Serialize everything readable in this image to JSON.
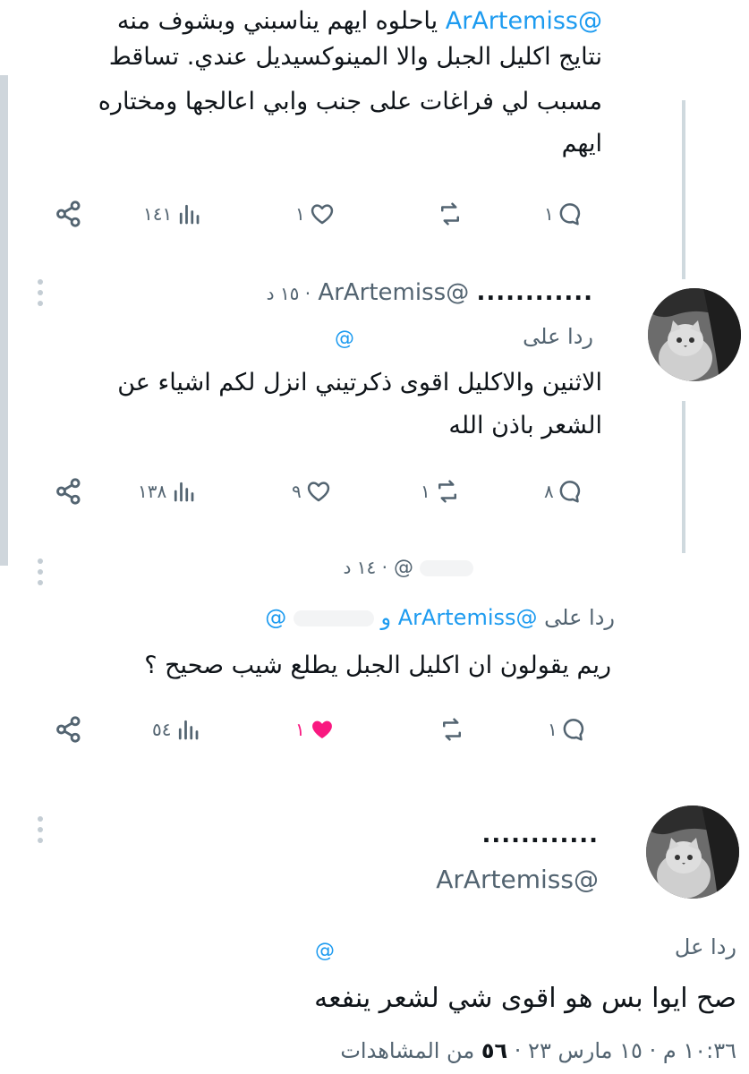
{
  "tweet1": {
    "line1_mention": "@ArArtemiss",
    "line1_rest": "ياحلوه ايهم يناسبني وبشوف منه",
    "line2": "نتايج اكليل الجبل والا المينوكسيديل عندي. تساقط",
    "line3": "مسبب لي فراغات على جنب وابي اعالجها ومختاره",
    "line4": "ايهم",
    "replies": "١",
    "retweets": "",
    "likes": "١",
    "views": "١٤١"
  },
  "tweet2": {
    "name": "............",
    "handle": "@ArArtemiss",
    "time": "· ١٥ د",
    "reply_to_label": "ردا على",
    "reply_to_handle": "@",
    "body_line1": "الاثنين والاكليل اقوى ذكرتيني انزل لكم اشياء عن",
    "body_line2": "الشعر باذن الله",
    "replies": "٨",
    "retweets": "١",
    "likes": "٩",
    "views": "١٣٨"
  },
  "tweet3": {
    "handle": "@",
    "time": "· ١٤ د",
    "reply_to_label": "ردا على",
    "reply_to_handle1": "@ArArtemiss",
    "reply_to_and": "و",
    "reply_to_handle2": "@",
    "body": "ريم يقولون ان اكليل الجبل يطلع شيب صحيح ؟",
    "replies": "١",
    "retweets": "",
    "likes": "١",
    "views": "٥٤"
  },
  "tweet4": {
    "name": "............",
    "handle": "@ArArtemiss",
    "reply_to_label": "ردا عل",
    "reply_to_handle": "@",
    "body": "صح ايوا بس هو اقوى شي لشعر ينفعه",
    "meta_time": "١٠:٣٦ م",
    "meta_date": "١٥ مارس ٢٣",
    "meta_views_count": "٥٦",
    "meta_views_label": "من المشاهدات"
  },
  "colors": {
    "link": "#1d9bf0",
    "text": "#0f1419",
    "secondary": "#536471",
    "like_active": "#f91880"
  }
}
